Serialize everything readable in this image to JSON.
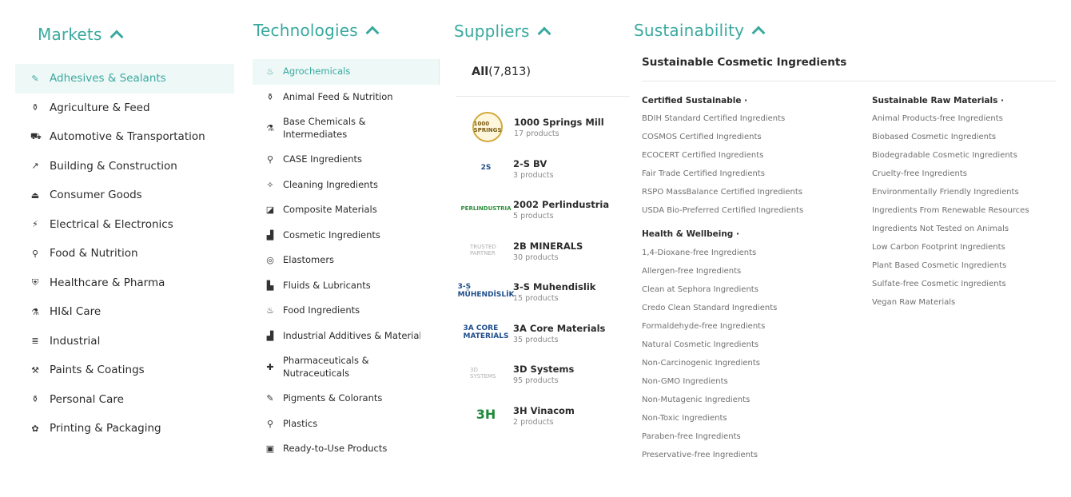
{
  "markets": {
    "title": "Markets",
    "items": [
      {
        "label": "Adhesives & Sealants",
        "icon": "✎",
        "active": true
      },
      {
        "label": "Agriculture & Feed",
        "icon": "⚱"
      },
      {
        "label": "Automotive & Transportation",
        "icon": "⛟"
      },
      {
        "label": "Building & Construction",
        "icon": "↗"
      },
      {
        "label": "Consumer Goods",
        "icon": "⏏"
      },
      {
        "label": "Electrical & Electronics",
        "icon": "⚡"
      },
      {
        "label": "Food & Nutrition",
        "icon": "⚲"
      },
      {
        "label": "Healthcare & Pharma",
        "icon": "⛨"
      },
      {
        "label": "HI&I Care",
        "icon": "⚗"
      },
      {
        "label": "Industrial",
        "icon": "≣"
      },
      {
        "label": "Paints & Coatings",
        "icon": "⚒"
      },
      {
        "label": "Personal Care",
        "icon": "⚱"
      },
      {
        "label": "Printing & Packaging",
        "icon": "✿"
      }
    ]
  },
  "technologies": {
    "title": "Technologies",
    "items": [
      {
        "label": "Agrochemicals",
        "icon": "♨",
        "active": true
      },
      {
        "label": "Animal Feed & Nutrition",
        "icon": "⚱"
      },
      {
        "label": "Base Chemicals & Intermediates",
        "icon": "⚗",
        "tall": true
      },
      {
        "label": "CASE Ingredients",
        "icon": "⚲"
      },
      {
        "label": "Cleaning Ingredients",
        "icon": "✧"
      },
      {
        "label": "Composite Materials",
        "icon": "◪"
      },
      {
        "label": "Cosmetic Ingredients",
        "icon": "▟"
      },
      {
        "label": "Elastomers",
        "icon": "◎"
      },
      {
        "label": "Fluids & Lubricants",
        "icon": "▙"
      },
      {
        "label": "Food Ingredients",
        "icon": "♨"
      },
      {
        "label": "Industrial Additives & Materials",
        "icon": "▟",
        "clip": true
      },
      {
        "label": "Pharmaceuticals & Nutraceuticals",
        "icon": "✚",
        "tall": true
      },
      {
        "label": "Pigments & Colorants",
        "icon": "✎"
      },
      {
        "label": "Plastics",
        "icon": "⚲"
      },
      {
        "label": "Ready-to-Use Products",
        "icon": "▣"
      }
    ]
  },
  "suppliers": {
    "title": "Suppliers",
    "all_label": "All",
    "all_count": "(7,813)",
    "items": [
      {
        "name": "1000 Springs Mill",
        "count": "17 products",
        "logo_text": "1000 SPRINGS",
        "logo_style": "round"
      },
      {
        "name": "2-S BV",
        "count": "3 products",
        "logo_text": "2S",
        "logo_style": "plain"
      },
      {
        "name": "2002 Perlindustria",
        "count": "5 products",
        "logo_text": "PERLINDUSTRIA",
        "logo_style": "green-text"
      },
      {
        "name": "2B MINERALS",
        "count": "30 products",
        "logo_text": "TRUSTED PARTNER",
        "logo_style": "gray"
      },
      {
        "name": "3-S Muhendislik",
        "count": "15 products",
        "logo_text": "3-S MÜHENDİSLİK",
        "logo_style": "plain"
      },
      {
        "name": "3A Core Materials",
        "count": "35 products",
        "logo_text": "3A CORE MATERIALS",
        "logo_style": "plain"
      },
      {
        "name": "3D Systems",
        "count": "95 products",
        "logo_text": "3D SYSTEMS",
        "logo_style": "gray"
      },
      {
        "name": "3H Vinacom",
        "count": "2 products",
        "logo_text": "3H",
        "logo_style": "big-green"
      }
    ]
  },
  "sustainability": {
    "title": "Sustainability",
    "section_title": "Sustainable Cosmetic Ingredients",
    "column1": [
      {
        "title": "Certified Sustainable ·",
        "links": [
          "BDIH Standard Certified Ingredients",
          "COSMOS Certified Ingredients",
          "ECOCERT Certified Ingredients",
          "Fair Trade Certified Ingredients",
          "RSPO MassBalance Certified Ingredients",
          "USDA Bio-Preferred Certified Ingredients"
        ]
      },
      {
        "title": "Health & Wellbeing ·",
        "links": [
          "1,4-Dioxane-free Ingredients",
          "Allergen-free Ingredients",
          "Clean at Sephora Ingredients",
          "Credo Clean Standard Ingredients",
          "Formaldehyde-free Ingredients",
          "Natural Cosmetic Ingredients",
          "Non-Carcinogenic Ingredients",
          "Non-GMO Ingredients",
          "Non-Mutagenic Ingredients",
          "Non-Toxic Ingredients",
          "Paraben-free Ingredients",
          "Preservative-free Ingredients"
        ]
      }
    ],
    "column2": [
      {
        "title": "Sustainable Raw Materials ·",
        "links": [
          "Animal Products-free Ingredients",
          "Biobased Cosmetic Ingredients",
          "Biodegradable Cosmetic Ingredients",
          "Cruelty-free Ingredients",
          "Environmentally Friendly Ingredients",
          "Ingredients From Renewable Resources",
          "Ingredients Not Tested on Animals",
          "Low Carbon Footprint Ingredients",
          "Plant Based Cosmetic Ingredients",
          "Sulfate-free Cosmetic Ingredients",
          "Vegan Raw Materials"
        ]
      }
    ]
  },
  "colors": {
    "accent": "#3aa99f",
    "active_bg": "#eef8f7",
    "text": "#2b2b2b",
    "muted": "#6f6f6f"
  }
}
